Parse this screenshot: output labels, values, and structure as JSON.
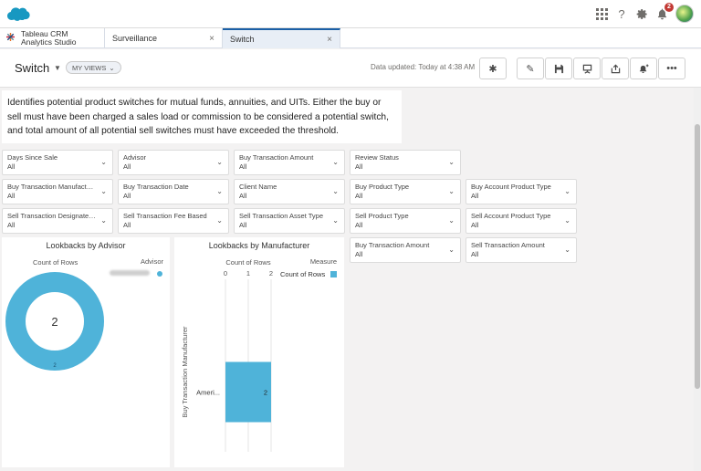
{
  "tabs": {
    "app_line1": "Tableau CRM",
    "app_line2": "Analytics Studio",
    "items": [
      {
        "label": "Surveillance"
      },
      {
        "label": "Switch"
      }
    ],
    "close_glyph": "×"
  },
  "topbar": {
    "notification_count": "2"
  },
  "header": {
    "title": "Switch",
    "my_views": "MY VIEWS",
    "updated": "Data updated: Today at 4:38 AM"
  },
  "description": "Identifies potential product switches for mutual funds, annuities, and UITs.   Either the buy or sell must have been charged a sales load or commission to be considered a potential switch, and total amount of all potential sell switches must have exceeded the threshold.",
  "filters": [
    {
      "label": "Days Since Sale",
      "value": "All"
    },
    {
      "label": "Advisor",
      "value": "All"
    },
    {
      "label": "Buy Transaction Amount",
      "value": "All"
    },
    {
      "label": "Review Status",
      "value": "All"
    },
    {
      "label": "Buy Transaction Manufacturer",
      "value": "All"
    },
    {
      "label": "Buy Transaction Date",
      "value": "All"
    },
    {
      "label": "Client Name",
      "value": "All"
    },
    {
      "label": "Buy Product Type",
      "value": "All"
    },
    {
      "label": "Buy Account Product Type",
      "value": "All"
    },
    {
      "label": "Sell Transaction Designated Rep",
      "value": "All"
    },
    {
      "label": "Sell Transaction Fee Based",
      "value": "All"
    },
    {
      "label": "Sell Transaction Asset Type",
      "value": "All"
    },
    {
      "label": "Sell Product Type",
      "value": "All"
    },
    {
      "label": "Sell Account Product Type",
      "value": "All"
    },
    {
      "label": "Buy Transaction Amount",
      "value": "All"
    },
    {
      "label": "Sell Transaction Amount",
      "value": "All"
    }
  ],
  "chart_data": [
    {
      "type": "pie",
      "title": "Lookbacks by Advisor",
      "measure_label": "Count of Rows",
      "legend_title": "Advisor",
      "center_value": "2",
      "slice_label": "2",
      "values": [
        2
      ],
      "color": "#4fb3d9"
    },
    {
      "type": "bar",
      "title": "Lookbacks by Manufacturer",
      "xlabel": "Count of Rows",
      "ylabel": "Buy Transaction Manufacturer",
      "legend_title": "Measure",
      "series": [
        {
          "name": "Count of Rows",
          "values": [
            2
          ]
        }
      ],
      "categories": [
        "Ameri..."
      ],
      "xticks": [
        "0",
        "1",
        "2"
      ],
      "xlim": [
        0,
        2
      ],
      "data_label": "2",
      "color": "#4fb3d9"
    }
  ]
}
